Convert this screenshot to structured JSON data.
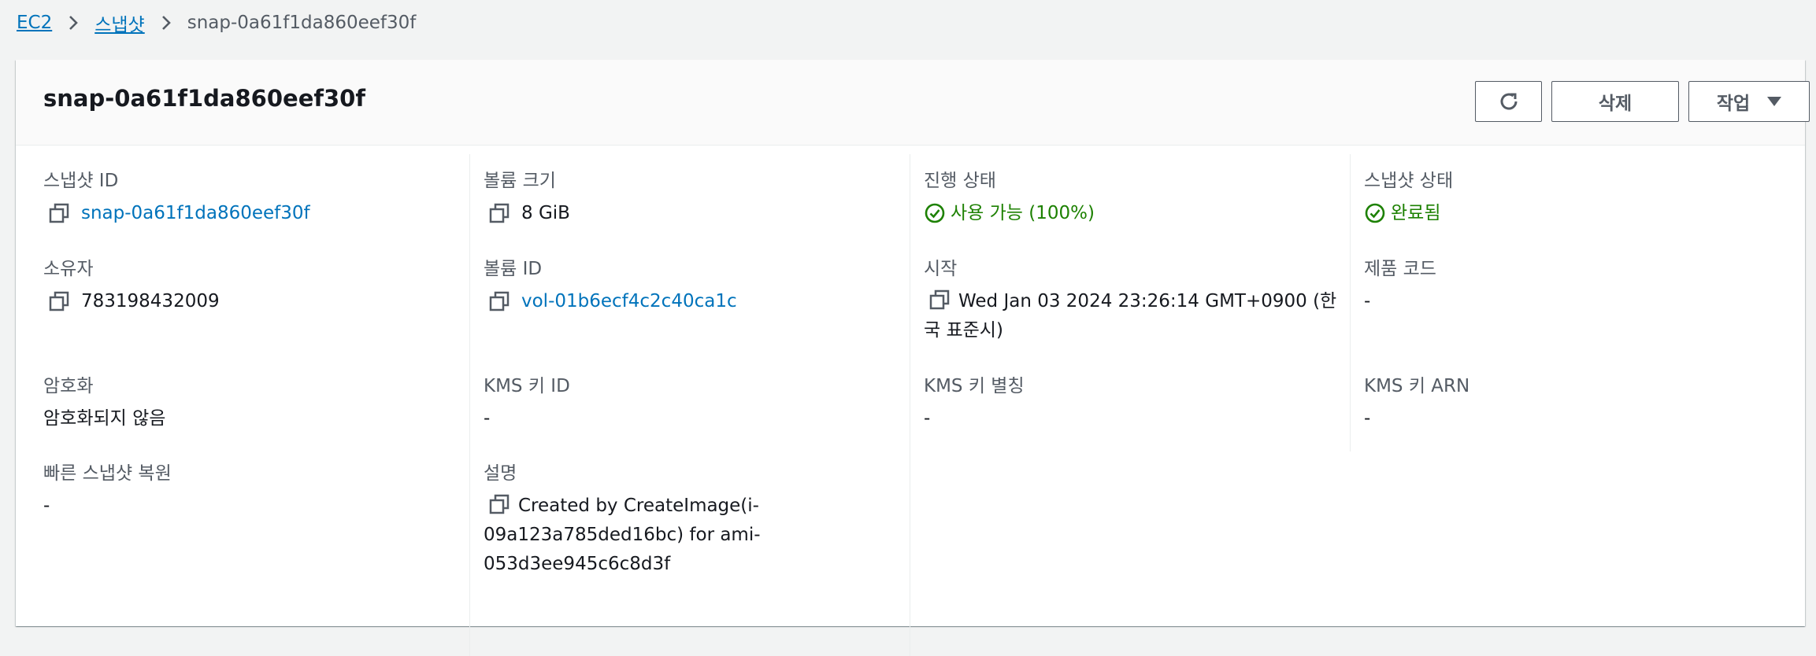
{
  "breadcrumb": {
    "ec2": "EC2",
    "snapshots": "스냅샷",
    "current": "snap-0a61f1da860eef30f"
  },
  "header": {
    "title": "snap-0a61f1da860eef30f",
    "delete_label": "삭제",
    "actions_label": "작업"
  },
  "details": {
    "snapshot_id": {
      "label": "스냅샷 ID",
      "value": "snap-0a61f1da860eef30f"
    },
    "volume_size": {
      "label": "볼륨 크기",
      "value": "8 GiB"
    },
    "progress": {
      "label": "진행 상태",
      "value": "사용 가능 (100%)"
    },
    "snapshot_status": {
      "label": "스냅샷 상태",
      "value": "완료됨"
    },
    "owner": {
      "label": "소유자",
      "value": "783198432009"
    },
    "volume_id": {
      "label": "볼륨 ID",
      "value": "vol-01b6ecf4c2c40ca1c"
    },
    "started": {
      "label": "시작",
      "value": "Wed Jan 03 2024 23:26:14 GMT+0900 (한국 표준시)"
    },
    "product_codes": {
      "label": "제품 코드",
      "value": "-"
    },
    "encryption": {
      "label": "암호화",
      "value": "암호화되지 않음"
    },
    "kms_key_id": {
      "label": "KMS 키 ID",
      "value": "-"
    },
    "kms_key_alias": {
      "label": "KMS 키 별칭",
      "value": "-"
    },
    "kms_key_arn": {
      "label": "KMS 키 ARN",
      "value": "-"
    },
    "fast_restore": {
      "label": "빠른 스냅샷 복원",
      "value": "-"
    },
    "description": {
      "label": "설명",
      "value": "Created by CreateImage(i-09a123a785ded16bc) for ami-053d3ee945c6c8d3f"
    }
  },
  "colors": {
    "link": "#0073bb",
    "success": "#1d8102",
    "label": "#545b64"
  },
  "icons": {
    "refresh": "refresh-icon",
    "copy": "copy-icon",
    "success": "check-circle-icon",
    "chevron": "chevron-right-icon",
    "caret": "caret-down-icon"
  }
}
